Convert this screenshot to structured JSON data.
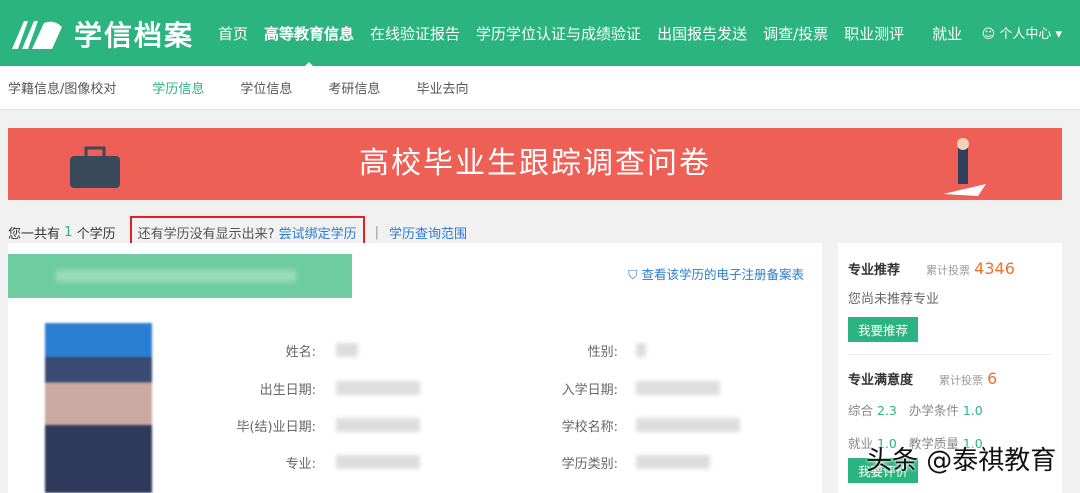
{
  "header": {
    "logo": "学信档案",
    "nav": [
      "首页",
      "高等教育信息",
      "在线验证报告",
      "学历学位认证与成绩验证",
      "出国报告发送",
      "调查/投票",
      "职业测评",
      "就业"
    ],
    "active_nav": 1,
    "user": "个人中心"
  },
  "subnav": {
    "items": [
      "学籍信息/图像校对",
      "学历信息",
      "学位信息",
      "考研信息",
      "毕业去向"
    ],
    "active": 1
  },
  "banner": {
    "title": "高校毕业生跟踪调查问卷"
  },
  "summary": {
    "prefix": "您一共有",
    "count": "1",
    "suffix": "个学历",
    "question": "还有学历没有显示出来?",
    "bind_link": "尝试绑定学历",
    "sep": "|",
    "range_link": "学历查询范围"
  },
  "record": {
    "reg_link": "查看该学历的电子注册备案表",
    "fields": [
      {
        "label": "姓名:"
      },
      {
        "label": "性别:"
      },
      {
        "label": "出生日期:"
      },
      {
        "label": "入学日期:"
      },
      {
        "label": "毕(结)业日期:"
      },
      {
        "label": "学校名称:"
      },
      {
        "label": "专业:"
      },
      {
        "label": "学历类别:"
      }
    ]
  },
  "sidebar": {
    "recommend": {
      "title": "专业推荐",
      "votes_label": "累计投票",
      "votes": "4346",
      "empty": "您尚未推荐专业",
      "button": "我要推荐"
    },
    "satisfaction": {
      "title": "专业满意度",
      "votes_label": "累计投票",
      "votes": "6",
      "items": [
        {
          "label": "综合",
          "value": "2.3"
        },
        {
          "label": "办学条件",
          "value": "1.0"
        },
        {
          "label": "就业",
          "value": "1.0"
        },
        {
          "label": "教学质量",
          "value": "1.0"
        }
      ],
      "button": "我要评价"
    }
  },
  "watermark": "头条 @泰祺教育",
  "colors": {
    "brand": "#2bb47f",
    "banner": "#ee5f55",
    "accent": "#f07030",
    "link": "#2a7bd0"
  }
}
